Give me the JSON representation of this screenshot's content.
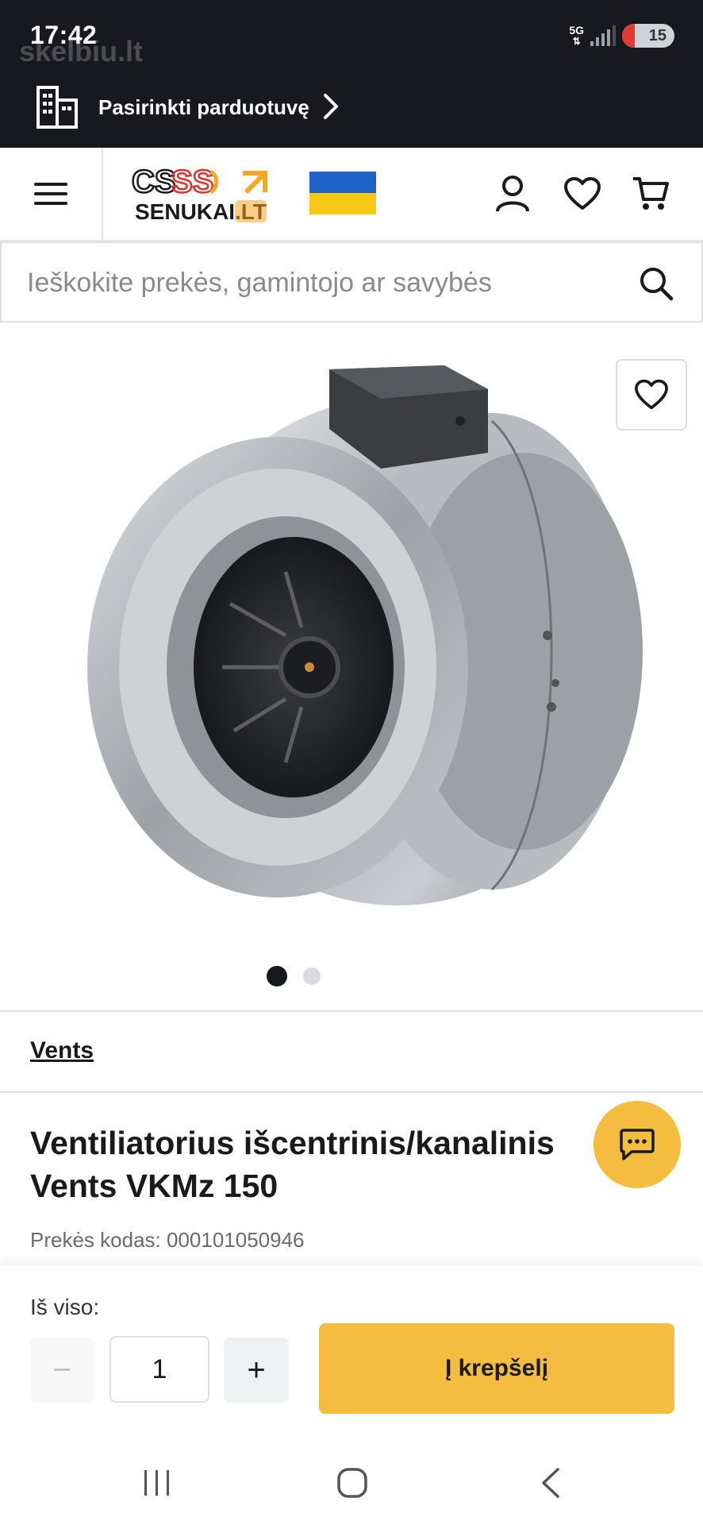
{
  "status": {
    "time": "17:42",
    "watermark": "skelbiu.lt",
    "network": "5G",
    "battery": "15"
  },
  "store": {
    "label": "Pasirinkti parduotuvę"
  },
  "header": {
    "logo_text": "SENUKAI.LT"
  },
  "search": {
    "placeholder": "Ieškokite prekės, gamintojo ar savybės"
  },
  "product": {
    "brand": "Vents",
    "title": "Ventiliatorius išcentrinis/kanalinis Vents VKMz 150",
    "code_label": "Prekės kodas:",
    "code_value": "000101050946"
  },
  "gallery": {
    "count": 2,
    "active_index": 0
  },
  "purchase": {
    "total_label": "Iš viso:",
    "quantity": "1",
    "minus": "−",
    "plus": "+",
    "add_to_cart": "Į krepšelį"
  },
  "colors": {
    "dark": "#17191f",
    "accent": "#f5bd3f",
    "logo_red": "#e2312d",
    "logo_orange": "#f5a623"
  }
}
